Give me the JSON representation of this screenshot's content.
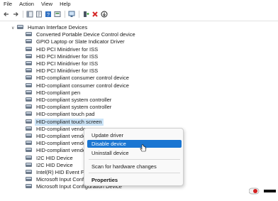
{
  "menubar": {
    "items": [
      "File",
      "Action",
      "View",
      "Help"
    ]
  },
  "toolbar": {
    "buttons": [
      "back-icon",
      "forward-icon",
      "show-hide-tree-icon",
      "properties-icon",
      "help-icon",
      "view-icon",
      "scan-icon",
      "update-driver-icon",
      "uninstall-icon",
      "disable-icon"
    ]
  },
  "tree": {
    "category": "Human Interface Devices",
    "devices": [
      "Converted Portable Device Control device",
      "GPIO Laptop or Slate Indicator Driver",
      "HID PCI Minidriver for ISS",
      "HID PCI Minidriver for ISS",
      "HID PCI Minidriver for ISS",
      "HID PCI Minidriver for ISS",
      "HID-compliant consumer control device",
      "HID-compliant consumer control device",
      "HID-compliant pen",
      "HID-compliant system controller",
      "HID-compliant system controller",
      "HID-compliant touch pad",
      "HID-compliant touch screen",
      "HID-compliant vendor",
      "HID-compliant vendor",
      "HID-compliant vendor",
      "HID-compliant vendor",
      "I2C HID Device",
      "I2C HID Device",
      "Intel(R) HID Event Filter",
      "Microsoft Input Configuration Device",
      "Microsoft Input Configuration Device"
    ],
    "selected_index": 12
  },
  "context_menu": {
    "update_driver": "Update driver",
    "disable_device": "Disable device",
    "uninstall_device": "Uninstall device",
    "scan": "Scan for hardware changes",
    "properties": "Properties"
  },
  "colors": {
    "selection": "#cce4f7",
    "menu_highlight": "#1a76d2"
  }
}
